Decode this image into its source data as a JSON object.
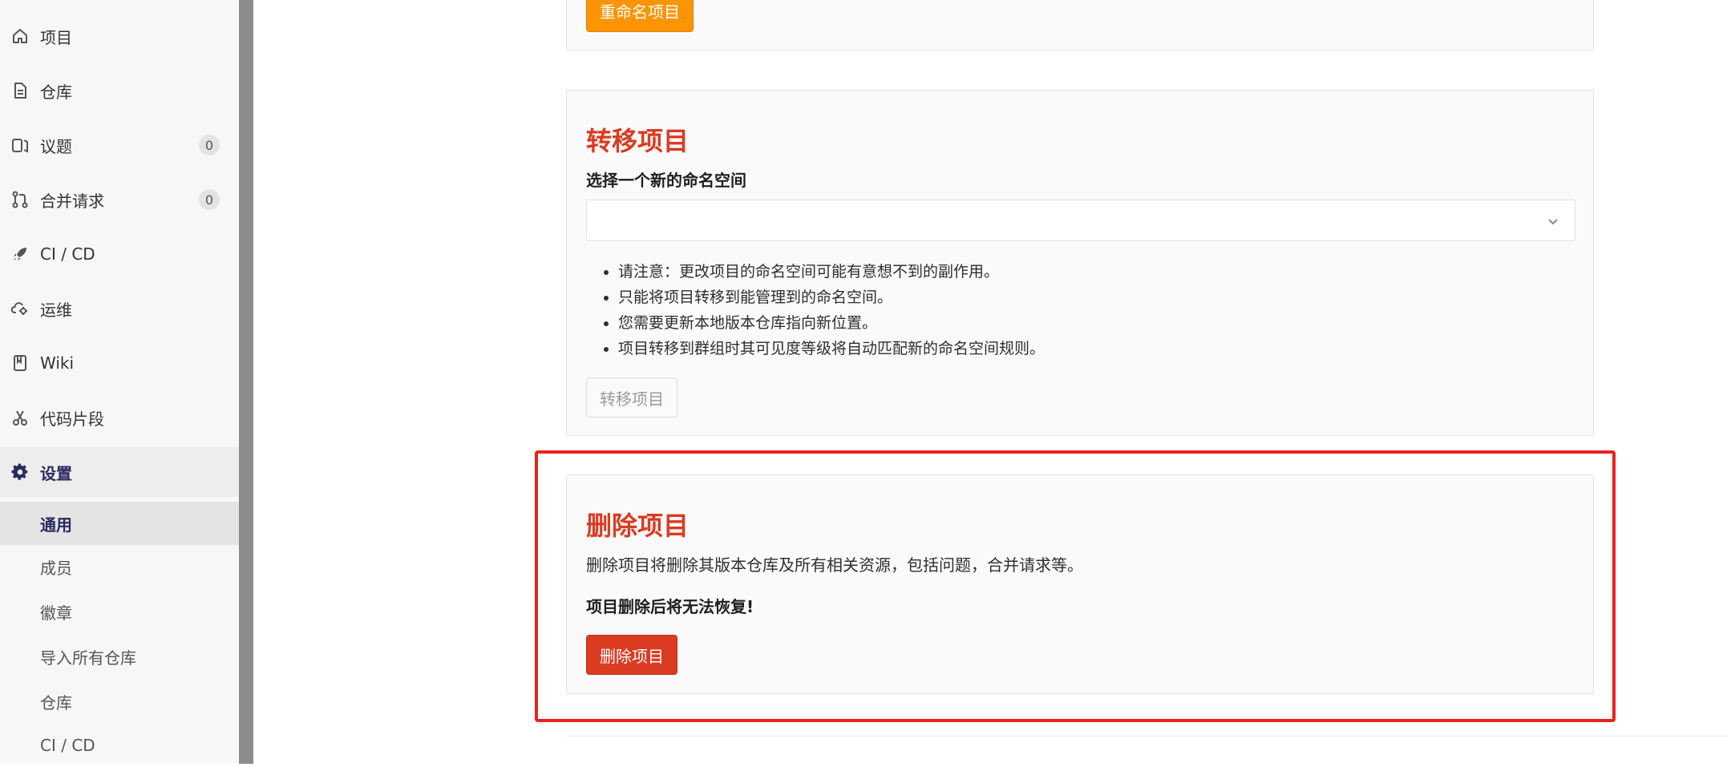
{
  "sidebar": {
    "items": [
      {
        "label": "项目",
        "icon": "home-icon"
      },
      {
        "label": "仓库",
        "icon": "document-icon"
      },
      {
        "label": "议题",
        "icon": "issues-icon",
        "badge": "0"
      },
      {
        "label": "合并请求",
        "icon": "merge-request-icon",
        "badge": "0"
      },
      {
        "label": "CI / CD",
        "icon": "rocket-icon"
      },
      {
        "label": "运维",
        "icon": "cloud-gear-icon"
      },
      {
        "label": "Wiki",
        "icon": "book-icon"
      },
      {
        "label": "代码片段",
        "icon": "scissors-icon"
      },
      {
        "label": "设置",
        "icon": "gear-icon"
      }
    ],
    "settings_subitems": [
      {
        "label": "通用"
      },
      {
        "label": "成员"
      },
      {
        "label": "徽章"
      },
      {
        "label": "导入所有仓库"
      },
      {
        "label": "仓库"
      },
      {
        "label": "CI / CD"
      }
    ]
  },
  "rename": {
    "button_label": "重命名项目"
  },
  "transfer": {
    "title": "转移项目",
    "namespace_label": "选择一个新的命名空间",
    "namespace_value": "",
    "notes": [
      "请注意：更改项目的命名空间可能有意想不到的副作用。",
      "只能将项目转移到能管理到的命名空间。",
      "您需要更新本地版本仓库指向新位置。",
      "项目转移到群组时其可见度等级将自动匹配新的命名空间规则。"
    ],
    "button_label": "转移项目"
  },
  "delete": {
    "title": "删除项目",
    "description": "删除项目将删除其版本仓库及所有相关资源，包括问题，合并请求等。",
    "warning": "项目删除后将无法恢复!",
    "button_label": "删除项目"
  },
  "colors": {
    "danger": "#db3b21",
    "rename_button": "#fc9403",
    "highlight": "#e8231d",
    "active_nav": "#2b2962"
  }
}
